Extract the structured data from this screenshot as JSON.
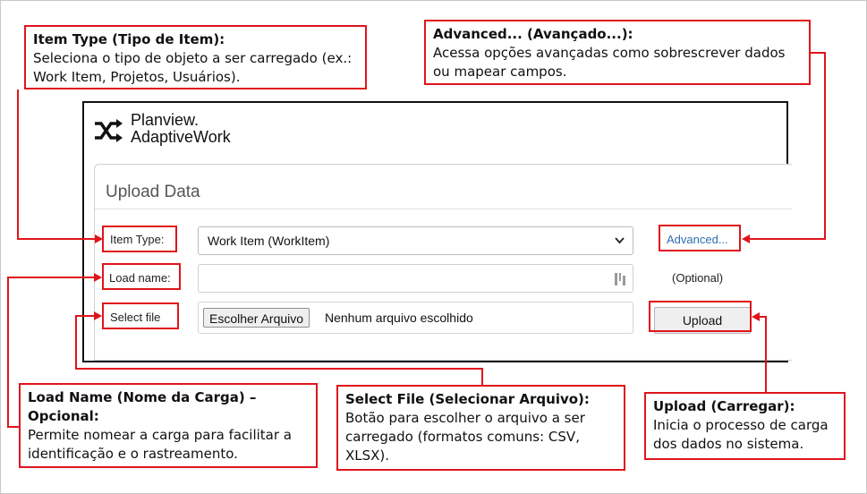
{
  "callouts": {
    "item_type": {
      "title": "Item Type (Tipo de Item):",
      "body": "Seleciona o tipo de objeto a ser carregado (ex.: Work Item, Projetos, Usuários)."
    },
    "advanced": {
      "title": "Advanced... (Avançado...):",
      "body": "Acessa opções avançadas como sobrescrever dados ou mapear campos."
    },
    "load_name": {
      "title": "Load Name (Nome da Carga) – Opcional:",
      "body": "Permite nomear a carga para facilitar a identificação e o rastreamento."
    },
    "select_file": {
      "title": "Select File (Selecionar Arquivo):",
      "body": "Botão para escolher o arquivo a ser carregado (formatos comuns: CSV, XLSX)."
    },
    "upload": {
      "title": "Upload (Carregar):",
      "body": "Inicia o processo de carga dos dados no sistema."
    }
  },
  "app": {
    "logo_line1": "Planview.",
    "logo_line2": "AdaptiveWork",
    "panel_title": "Upload Data",
    "item_type_label": "Item Type:",
    "item_type_value": "Work Item (WorkItem)",
    "advanced_link": "Advanced...",
    "load_name_label": "Load name:",
    "load_name_value": "",
    "optional_text": "(Optional)",
    "select_file_label": "Select file",
    "choose_file_button": "Escolher Arquivo",
    "no_file_text": "Nenhum arquivo escolhido",
    "upload_button": "Upload"
  },
  "colors": {
    "accent": "#e0141b",
    "link": "#2f6fb0"
  }
}
